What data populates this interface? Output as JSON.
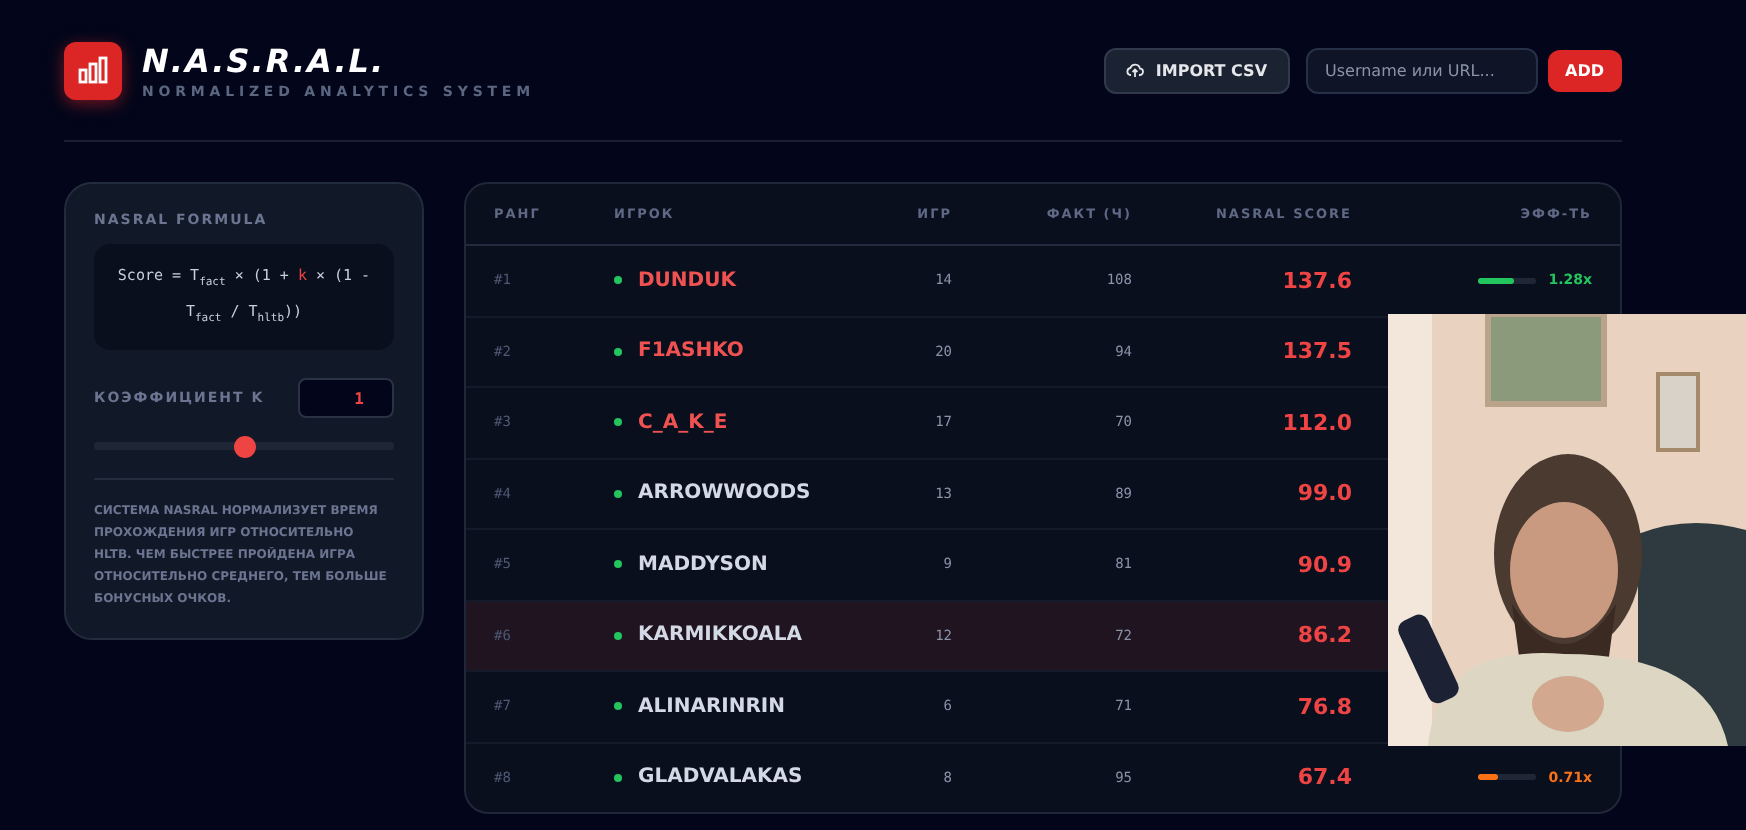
{
  "header": {
    "logo_title": "N.A.S.R.A.L.",
    "subtitle": "NORMALIZED ANALYTICS SYSTEM",
    "import_button": "IMPORT CSV",
    "search": {
      "placeholder": "Username или URL..."
    },
    "add_button": "ADD"
  },
  "formula_card": {
    "title": "NASRAL FORMULA",
    "formula": [
      {
        "text": "Score = T$_{fact}$ × (1 + ",
        "accent": false
      },
      {
        "text": "k",
        "accent": true
      },
      {
        "text": " × (1 - T$_{fact}$ / T$_{hltb}$))",
        "accent": false
      }
    ],
    "coefficient_label": "КОЭФФИЦИЕНТ K",
    "coefficient_value": "1",
    "slider": {
      "level": 0.5
    },
    "description": "СИСТЕМА NASRAL НОРМАЛИЗУЕТ ВРЕМЯ ПРОХОЖДЕНИЯ ИГР ОТНОСИТЕЛЬНО HLTB. ЧЕМ БЫСТРЕЕ ПРОЙДЕНА ИГРА ОТНОСИТЕЛЬНО СРЕДНЕГО, ТЕМ БОЛЬШЕ БОНУСНЫХ ОЧКОВ."
  },
  "table": {
    "columns": [
      "РАНГ",
      "ИГРОК",
      "ИГР",
      "ФАКТ (Ч)",
      "NASRAL SCORE",
      "ЭФФ-ТЬ"
    ],
    "rows": [
      {
        "rank": "#1",
        "player": "DUNDUK",
        "top": true,
        "highlighted": false,
        "online": true,
        "games": "14",
        "hours": "108",
        "score": "137.6",
        "efficiency": {
          "level": 0.6,
          "color": "#22c55e",
          "value": "1.28x"
        }
      },
      {
        "rank": "#2",
        "player": "F1ASHKO",
        "top": true,
        "highlighted": false,
        "online": true,
        "games": "20",
        "hours": "94",
        "score": "137.5"
      },
      {
        "rank": "#3",
        "player": "C_A_K_E",
        "top": true,
        "highlighted": false,
        "online": true,
        "games": "17",
        "hours": "70",
        "score": "112.0"
      },
      {
        "rank": "#4",
        "player": "ARROWWOODS",
        "top": false,
        "highlighted": false,
        "online": true,
        "games": "13",
        "hours": "89",
        "score": "99.0"
      },
      {
        "rank": "#5",
        "player": "MADDYSON",
        "top": false,
        "highlighted": false,
        "online": true,
        "games": "9",
        "hours": "81",
        "score": "90.9"
      },
      {
        "rank": "#6",
        "player": "KARMIKKOALA",
        "top": false,
        "highlighted": true,
        "online": true,
        "games": "12",
        "hours": "72",
        "score": "86.2"
      },
      {
        "rank": "#7",
        "player": "ALINARINRIN",
        "top": false,
        "highlighted": false,
        "online": true,
        "games": "6",
        "hours": "71",
        "score": "76.8"
      },
      {
        "rank": "#8",
        "player": "GLADVALAKAS",
        "top": false,
        "highlighted": false,
        "online": true,
        "games": "8",
        "hours": "95",
        "score": "67.4",
        "efficiency": {
          "level": 0.35,
          "color": "#f97316",
          "value": "0.71x"
        }
      }
    ]
  }
}
